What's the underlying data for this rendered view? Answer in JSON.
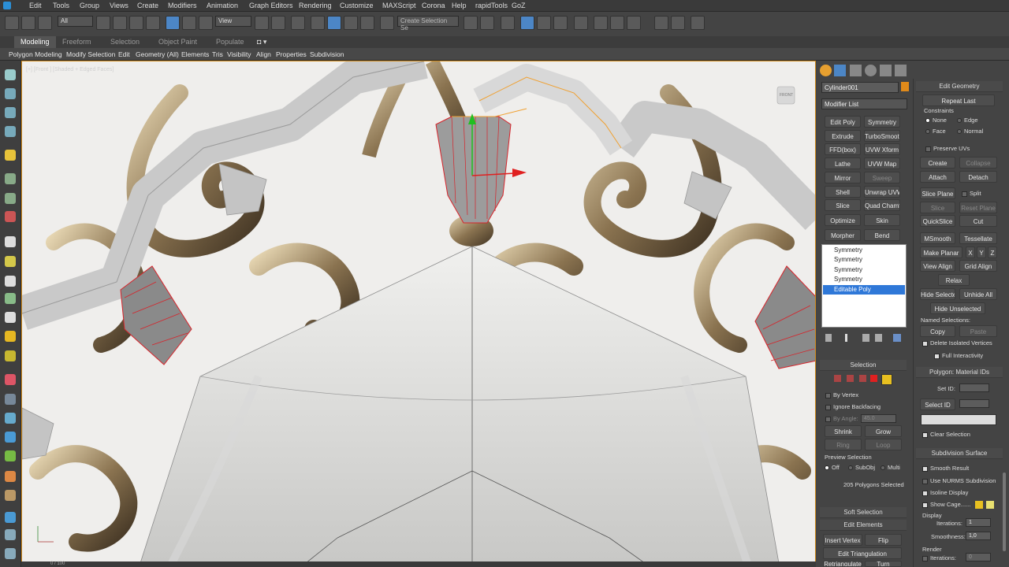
{
  "menu": [
    "Edit",
    "Tools",
    "Group",
    "Views",
    "Create",
    "Modifiers",
    "Animation",
    "Graph Editors",
    "Rendering",
    "Customize",
    "MAXScript",
    "Corona",
    "Help",
    "rapidTools",
    "GoZ"
  ],
  "toolbar": {
    "filter_select": "All",
    "refcoord_select": "View",
    "named_selection": "Create Selection Se"
  },
  "ribbon_tabs": [
    "Modeling",
    "Freeform",
    "Selection",
    "Object Paint",
    "Populate"
  ],
  "ribbon_items": [
    "Polygon Modeling",
    "Modify Selection",
    "Edit",
    "Geometry (All)",
    "Elements",
    "Tris",
    "Visibility",
    "Align",
    "Properties",
    "Subdivision"
  ],
  "viewport": {
    "label": "[+] [Front ] [Shaded + Edged Faces]",
    "viewcube_label": "FRONT",
    "status_left": "0 / 100"
  },
  "command_panel": {
    "object_name": "Cylinder001",
    "object_color": "#e08a1a",
    "modifier_list": "Modifier List",
    "modifier_buttons": [
      [
        "Edit Poly",
        "Symmetry"
      ],
      [
        "Extrude",
        "TurboSmooth"
      ],
      [
        "FFD(box)",
        "UVW Xform"
      ],
      [
        "Lathe",
        "UVW Map"
      ],
      [
        "Mirror",
        "Sweep"
      ],
      [
        "Shell",
        "Unwrap UVW"
      ],
      [
        "Slice",
        "Quad Chamfer"
      ],
      [
        "Optimize",
        "Skin"
      ],
      [
        "Morpher",
        "Bend"
      ]
    ],
    "stack": [
      "Symmetry",
      "Symmetry",
      "Symmetry",
      "Symmetry",
      "Editable Poly"
    ],
    "selection_title": "Selection",
    "by_vertex": "By Vertex",
    "ignore_backfacing": "Ignore Backfacing",
    "by_angle": "By Angle:",
    "by_angle_value": "45.0",
    "shrink": "Shrink",
    "grow": "Grow",
    "ring": "Ring",
    "loop": "Loop",
    "preview_selection": "Preview Selection",
    "preview_off": "Off",
    "preview_subobj": "SubObj",
    "preview_multi": "Multi",
    "selected_count": "205 Polygons Selected",
    "soft_selection": "Soft Selection",
    "edit_elements": "Edit Elements",
    "insert_vertex": "Insert Vertex",
    "flip": "Flip",
    "edit_triangulation": "Edit Triangulation",
    "retriangulate": "Retriangulate",
    "turn": "Turn"
  },
  "edit_geometry": {
    "title": "Edit Geometry",
    "repeat_last": "Repeat Last",
    "constraints": "Constraints",
    "none": "None",
    "edge": "Edge",
    "face": "Face",
    "normal": "Normal",
    "preserve_uvs": "Preserve UVs",
    "create": "Create",
    "collapse": "Collapse",
    "attach": "Attach",
    "detach": "Detach",
    "slice_plane": "Slice Plane",
    "split": "Split",
    "slice": "Slice",
    "reset_plane": "Reset Plane",
    "quickslice": "QuickSlice",
    "cut": "Cut",
    "msmooth": "MSmooth",
    "tessellate": "Tessellate",
    "make_planar": "Make Planar",
    "x": "X",
    "y": "Y",
    "z": "Z",
    "view_align": "View Align",
    "grid_align": "Grid Align",
    "relax": "Relax",
    "hide_selected": "Hide Selected",
    "unhide_all": "Unhide All",
    "hide_unselected": "Hide Unselected",
    "named_selections": "Named Selections:",
    "copy": "Copy",
    "paste": "Paste",
    "delete_isolated": "Delete Isolated Vertices",
    "full_interactivity": "Full Interactivity"
  },
  "material_ids": {
    "title": "Polygon: Material IDs",
    "set_id": "Set ID:",
    "select_id": "Select ID",
    "clear_selection": "Clear Selection"
  },
  "subdivision_surface": {
    "title": "Subdivision Surface",
    "smooth_result": "Smooth Result",
    "use_nurms": "Use NURMS Subdivision",
    "isoline_display": "Isoline Display",
    "show_cage": "Show Cage......",
    "display": "Display",
    "iterations_label": "Iterations:",
    "iterations_value": "1",
    "smoothness_label": "Smoothness:",
    "smoothness_value": "1,0",
    "render": "Render",
    "render_iterations_label": "Iterations:",
    "render_iterations_value": "0"
  },
  "colors": {
    "selection_blue": "#2f78d8",
    "active_tool": "#4c86c6",
    "cage_yellow": "#e8c020",
    "selected_edges": "#d7232a",
    "orange_selection": "#f0a030"
  }
}
